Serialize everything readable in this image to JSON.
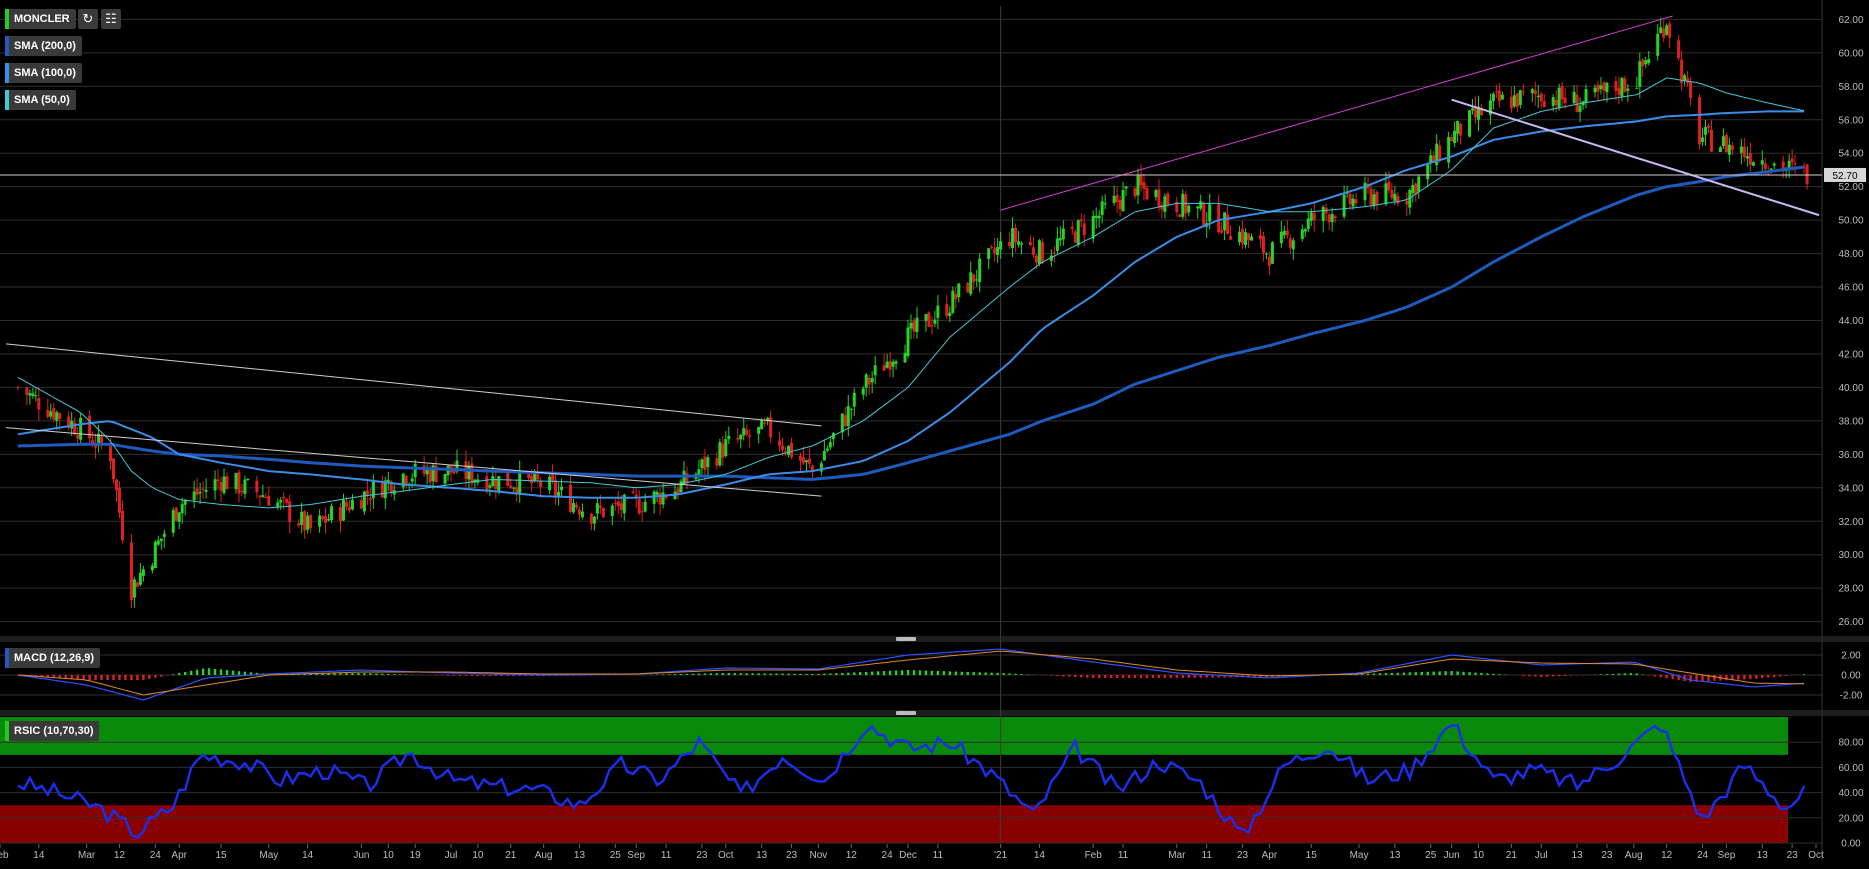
{
  "symbol": "MONCLER",
  "toolbar": {
    "refresh_icon": "refresh-icon",
    "settings_icon": "chart-settings-icon"
  },
  "indicators": {
    "sma200": {
      "label": "SMA (200,0)",
      "color": "#1f5bbf"
    },
    "sma100": {
      "label": "SMA (100,0)",
      "color": "#3b8ee8"
    },
    "sma50": {
      "label": "SMA (50,0)",
      "color": "#44c7d8"
    },
    "macd": {
      "label": "MACD (12,26,9)"
    },
    "rsi": {
      "label": "RSIC (10,70,30)"
    }
  },
  "last_price_label": "52.70",
  "chart_data": [
    {
      "type": "candlestick",
      "title": "MONCLER",
      "ylim": [
        25.5,
        62.8
      ],
      "y_ticks": [
        "26.00",
        "28.00",
        "30.00",
        "32.00",
        "34.00",
        "36.00",
        "38.00",
        "40.00",
        "42.00",
        "44.00",
        "46.00",
        "48.00",
        "50.00",
        "52.00",
        "54.00",
        "56.00",
        "58.00",
        "60.00",
        "62.00"
      ],
      "last_price": 52.7,
      "trend_samples": {
        "x": [
          "2020-02-07",
          "2020-02-28",
          "2020-03-09",
          "2020-03-16",
          "2020-03-23",
          "2020-04-01",
          "2020-04-15",
          "2020-05-01",
          "2020-05-15",
          "2020-06-01",
          "2020-06-15",
          "2020-07-01",
          "2020-07-15",
          "2020-08-01",
          "2020-08-17",
          "2020-09-01",
          "2020-09-15",
          "2020-10-01",
          "2020-10-15",
          "2020-10-30",
          "2020-11-16",
          "2020-12-01",
          "2020-12-15",
          "2021-01-04",
          "2021-01-15",
          "2021-02-01",
          "2021-02-15",
          "2021-03-01",
          "2021-03-15",
          "2021-04-01",
          "2021-04-15",
          "2021-05-03",
          "2021-05-17",
          "2021-06-01",
          "2021-06-15",
          "2021-07-01",
          "2021-07-15",
          "2021-08-02",
          "2021-08-12",
          "2021-08-23",
          "2021-09-01",
          "2021-09-15",
          "2021-09-28"
        ],
        "close": [
          40,
          37.5,
          36,
          28,
          30,
          33,
          34.5,
          33.5,
          31.5,
          33.5,
          34.8,
          35,
          34.5,
          34.2,
          32.5,
          33,
          34,
          36.5,
          37.5,
          35,
          40,
          43,
          45,
          49,
          48,
          50,
          52,
          51,
          50,
          48,
          50,
          51.5,
          51.5,
          55,
          57,
          57.5,
          57,
          58.5,
          62,
          55,
          54.5,
          53.5,
          52.7
        ],
        "sma50": [
          40.6,
          38.5,
          36.8,
          35,
          34,
          33.3,
          33,
          32.8,
          33,
          33.5,
          33.8,
          34.2,
          34.5,
          34.4,
          34.3,
          34,
          34.2,
          34.8,
          35.8,
          36.5,
          38,
          40,
          43,
          46,
          47.5,
          49,
          50.5,
          51,
          51,
          50.5,
          50.5,
          50.8,
          51.2,
          53,
          55.5,
          56.5,
          57,
          57.5,
          58.5,
          58.2,
          57.6,
          57,
          56.5
        ],
        "sma100": [
          37.2,
          37.8,
          38,
          37.5,
          37,
          36,
          35.5,
          35,
          34.8,
          34.5,
          34.2,
          34,
          33.8,
          33.5,
          33.4,
          33.4,
          33.6,
          34.2,
          34.8,
          35,
          35.6,
          36.8,
          38.5,
          41.5,
          43.5,
          45.5,
          47.5,
          49,
          50,
          50.5,
          51,
          52,
          53,
          53.8,
          54.8,
          55.3,
          55.6,
          55.9,
          56.2,
          56.3,
          56.4,
          56.5,
          56.5
        ],
        "sma200": [
          36.5,
          36.6,
          36.6,
          36.4,
          36.2,
          36,
          35.9,
          35.7,
          35.5,
          35.3,
          35.2,
          35.1,
          35,
          34.9,
          34.8,
          34.7,
          34.7,
          34.7,
          34.6,
          34.5,
          34.8,
          35.5,
          36.2,
          37.2,
          38,
          39,
          40.2,
          41,
          41.8,
          42.5,
          43.2,
          44,
          44.8,
          46,
          47.5,
          49,
          50.2,
          51.5,
          52,
          52.3,
          52.6,
          52.9,
          53.2
        ]
      },
      "trendlines": [
        {
          "name": "upper-channel",
          "color": "#d43fd4",
          "from": [
            "2021-01-01",
            50.6
          ],
          "to": [
            "2021-08-14",
            62.2
          ]
        },
        {
          "name": "lower-channel",
          "color": "#c8b8f0",
          "from": [
            "2021-06-01",
            57.2
          ],
          "to": [
            "2021-10-02",
            50.3
          ]
        },
        {
          "name": "long-downtrend",
          "color": "#d0d0d0",
          "from": [
            "2020-02-03",
            42.6
          ],
          "to": [
            "2020-11-02",
            37.7
          ]
        },
        {
          "name": "support-line",
          "color": "#d0d0d0",
          "from": [
            "2020-02-03",
            37.6
          ],
          "to": [
            "2020-11-02",
            33.5
          ]
        }
      ]
    },
    {
      "type": "bar+line",
      "title": "MACD (12,26,9)",
      "ylim": [
        -3.0,
        3.0
      ],
      "y_ticks": [
        "2.00",
        "0.00",
        "-2.00"
      ],
      "samples": {
        "x": [
          "2020-02-07",
          "2020-03-01",
          "2020-03-20",
          "2020-04-10",
          "2020-05-01",
          "2020-06-01",
          "2020-07-01",
          "2020-08-01",
          "2020-09-01",
          "2020-10-01",
          "2020-11-01",
          "2020-12-01",
          "2021-01-01",
          "2021-02-01",
          "2021-03-01",
          "2021-04-01",
          "2021-05-01",
          "2021-06-01",
          "2021-07-01",
          "2021-08-01",
          "2021-08-20",
          "2021-09-10",
          "2021-09-28"
        ],
        "macd": [
          0.0,
          -1.0,
          -2.5,
          -0.3,
          0.1,
          0.5,
          0.2,
          0.0,
          0.1,
          0.7,
          0.6,
          2.0,
          2.6,
          1.3,
          0.2,
          -0.3,
          0.2,
          2.0,
          1.0,
          1.3,
          -0.5,
          -1.2,
          -0.8
        ],
        "signal": [
          0.0,
          -0.5,
          -2.0,
          -1.0,
          0.0,
          0.3,
          0.3,
          0.1,
          0.1,
          0.5,
          0.5,
          1.5,
          2.4,
          1.6,
          0.5,
          -0.1,
          0.1,
          1.6,
          1.2,
          1.1,
          0.2,
          -0.8,
          -0.9
        ]
      }
    },
    {
      "type": "line",
      "title": "RSIC (10,70,30)",
      "ylim": [
        0,
        100
      ],
      "y_ticks": [
        "80.00",
        "60.00",
        "40.00",
        "20.00",
        "0.00"
      ],
      "overbought": 70,
      "oversold": 30,
      "samples": {
        "x": [
          "2020-02-07",
          "2020-02-20",
          "2020-03-05",
          "2020-03-18",
          "2020-03-30",
          "2020-04-08",
          "2020-04-22",
          "2020-05-05",
          "2020-05-20",
          "2020-06-03",
          "2020-06-17",
          "2020-07-01",
          "2020-07-15",
          "2020-07-30",
          "2020-08-13",
          "2020-08-27",
          "2020-09-09",
          "2020-09-22",
          "2020-10-06",
          "2020-10-20",
          "2020-11-03",
          "2020-11-17",
          "2020-12-01",
          "2020-12-15",
          "2020-12-29",
          "2021-01-12",
          "2021-01-26",
          "2021-02-09",
          "2021-02-23",
          "2021-03-09",
          "2021-03-23",
          "2021-04-06",
          "2021-04-20",
          "2021-05-04",
          "2021-05-18",
          "2021-06-01",
          "2021-06-15",
          "2021-06-29",
          "2021-07-13",
          "2021-07-27",
          "2021-08-10",
          "2021-08-24",
          "2021-09-07",
          "2021-09-21",
          "2021-09-28"
        ],
        "values": [
          48,
          40,
          28,
          8,
          30,
          70,
          65,
          50,
          58,
          45,
          72,
          50,
          45,
          42,
          30,
          62,
          50,
          80,
          38,
          70,
          50,
          95,
          75,
          80,
          55,
          22,
          75,
          42,
          65,
          48,
          5,
          62,
          78,
          50,
          58,
          95,
          50,
          58,
          46,
          68,
          95,
          18,
          62,
          28,
          42
        ]
      }
    }
  ],
  "x_axis": {
    "labels": [
      {
        "date": "2020-02-01",
        "text": "Feb"
      },
      {
        "date": "2020-02-14",
        "text": "14"
      },
      {
        "date": "2020-03-01",
        "text": "Mar"
      },
      {
        "date": "2020-03-12",
        "text": "12"
      },
      {
        "date": "2020-03-24",
        "text": "24"
      },
      {
        "date": "2020-04-01",
        "text": "Apr"
      },
      {
        "date": "2020-04-15",
        "text": "15"
      },
      {
        "date": "2020-05-01",
        "text": "May"
      },
      {
        "date": "2020-05-14",
        "text": "14"
      },
      {
        "date": "2020-06-01",
        "text": "Jun"
      },
      {
        "date": "2020-06-10",
        "text": "10"
      },
      {
        "date": "2020-06-19",
        "text": "19"
      },
      {
        "date": "2020-07-01",
        "text": "Jul"
      },
      {
        "date": "2020-07-10",
        "text": "10"
      },
      {
        "date": "2020-07-21",
        "text": "21"
      },
      {
        "date": "2020-08-01",
        "text": "Aug"
      },
      {
        "date": "2020-08-13",
        "text": "13"
      },
      {
        "date": "2020-08-25",
        "text": "25"
      },
      {
        "date": "2020-09-01",
        "text": "Sep"
      },
      {
        "date": "2020-09-11",
        "text": "11"
      },
      {
        "date": "2020-09-23",
        "text": "23"
      },
      {
        "date": "2020-10-01",
        "text": "Oct"
      },
      {
        "date": "2020-10-13",
        "text": "13"
      },
      {
        "date": "2020-10-23",
        "text": "23"
      },
      {
        "date": "2020-11-01",
        "text": "Nov"
      },
      {
        "date": "2020-11-12",
        "text": "12"
      },
      {
        "date": "2020-11-24",
        "text": "24"
      },
      {
        "date": "2020-12-01",
        "text": "Dec"
      },
      {
        "date": "2020-12-11",
        "text": "11"
      },
      {
        "date": "2021-01-01",
        "text": "'21"
      },
      {
        "date": "2021-01-14",
        "text": "14"
      },
      {
        "date": "2021-02-01",
        "text": "Feb"
      },
      {
        "date": "2021-02-11",
        "text": "11"
      },
      {
        "date": "2021-03-01",
        "text": "Mar"
      },
      {
        "date": "2021-03-11",
        "text": "11"
      },
      {
        "date": "2021-03-23",
        "text": "23"
      },
      {
        "date": "2021-04-01",
        "text": "Apr"
      },
      {
        "date": "2021-04-15",
        "text": "15"
      },
      {
        "date": "2021-05-01",
        "text": "May"
      },
      {
        "date": "2021-05-13",
        "text": "13"
      },
      {
        "date": "2021-05-25",
        "text": "25"
      },
      {
        "date": "2021-06-01",
        "text": "Jun"
      },
      {
        "date": "2021-06-10",
        "text": "10"
      },
      {
        "date": "2021-06-21",
        "text": "21"
      },
      {
        "date": "2021-07-01",
        "text": "Jul"
      },
      {
        "date": "2021-07-13",
        "text": "13"
      },
      {
        "date": "2021-07-23",
        "text": "23"
      },
      {
        "date": "2021-08-01",
        "text": "Aug"
      },
      {
        "date": "2021-08-12",
        "text": "12"
      },
      {
        "date": "2021-08-24",
        "text": "24"
      },
      {
        "date": "2021-09-01",
        "text": "Sep"
      },
      {
        "date": "2021-09-13",
        "text": "13"
      },
      {
        "date": "2021-09-23",
        "text": "23"
      },
      {
        "date": "2021-10-01",
        "text": "Oct"
      }
    ]
  },
  "colors": {
    "up": "#29d129",
    "down": "#e02020",
    "rsi_line": "#1a2fe8",
    "overbought_zone": "#0a8a0a",
    "oversold_zone": "#8a0000",
    "grid": "#2e2e2e",
    "axis_text": "#bdbdbd"
  }
}
